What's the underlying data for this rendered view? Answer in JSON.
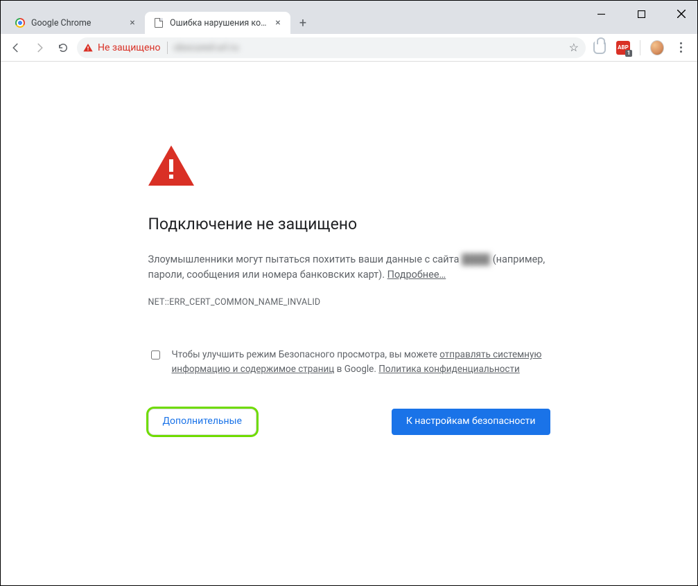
{
  "window": {
    "minimize_aria": "Minimize",
    "maximize_aria": "Maximize",
    "close_aria": "Close"
  },
  "tabs": [
    {
      "label": "Google Chrome",
      "active": false
    },
    {
      "label": "Ошибка нарушения конфиденц",
      "active": true
    }
  ],
  "newtab_aria": "New tab",
  "toolbar": {
    "back_aria": "Назад",
    "forward_aria": "Вперёд",
    "reload_aria": "Обновить",
    "security_label": "Не защищено",
    "url_display": "",
    "star_aria": "Добавить в закладки",
    "ext_yandex_aria": "Яндекс",
    "ext_abp_label": "ABP",
    "ext_abp_badge": "1",
    "avatar_aria": "Профиль",
    "menu_aria": "Меню"
  },
  "interstitial": {
    "title": "Подключение не защищено",
    "body_pre": "Злоумышленники могут пытаться похитить ваши данные с сайта ",
    "body_site_blurred": "████",
    "body_post": " (например, пароли, сообщения или номера банковских карт). ",
    "learn_more": "Подробнее…",
    "error_code": "NET::ERR_CERT_COMMON_NAME_INVALID",
    "optin_pre": "Чтобы улучшить режим Безопасного просмотра, вы можете ",
    "optin_link1": "отправлять системную информацию и содержимое страниц",
    "optin_mid": " в Google. ",
    "optin_link2": "Политика конфиденциальности",
    "btn_secondary": "Дополнительные",
    "btn_primary": "К настройкам безопасности"
  }
}
